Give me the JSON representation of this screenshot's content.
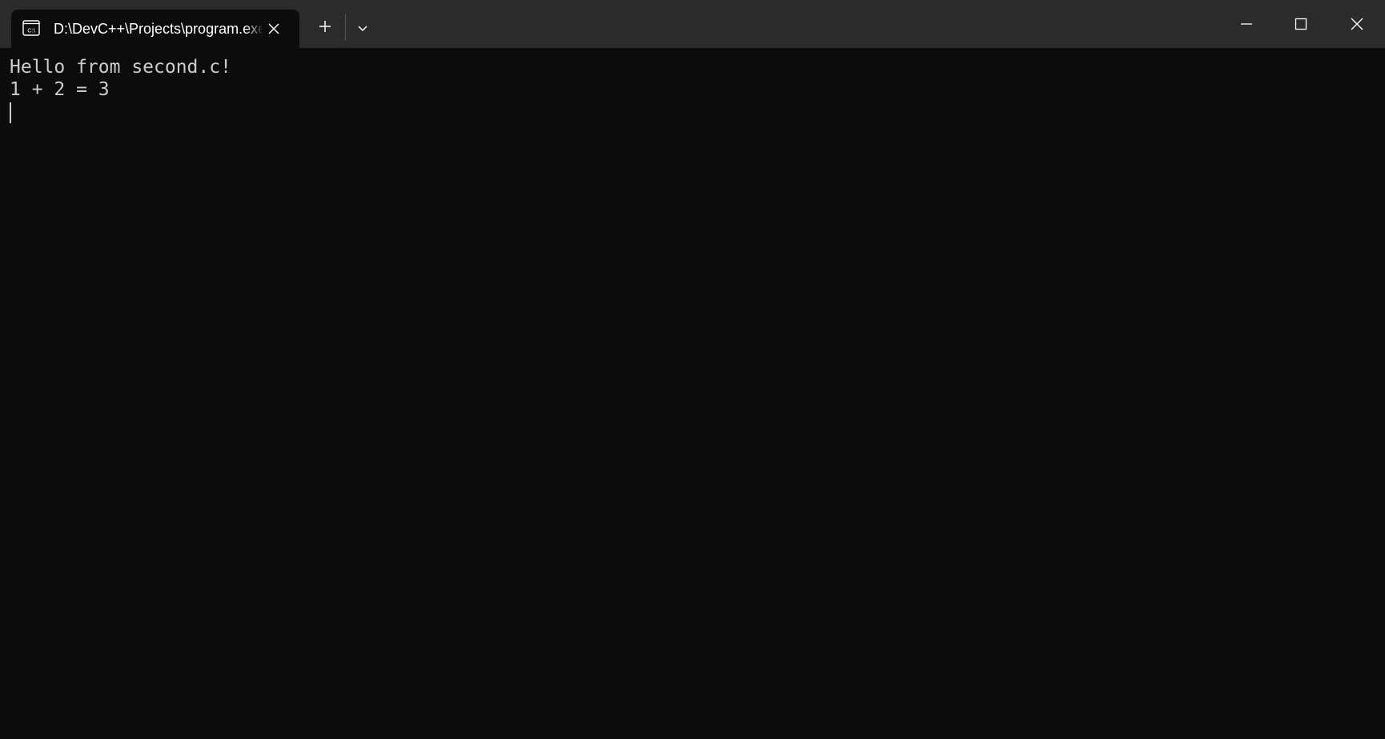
{
  "window": {
    "tab_title": "D:\\DevC++\\Projects\\program.exe",
    "tab_icon": "cmd-console-icon",
    "colors": {
      "titlebar": "#2b2b2b",
      "background": "#0c0c0c",
      "text": "#cccccc"
    }
  },
  "console": {
    "lines": [
      "Hello from second.c!",
      "1 + 2 = 3"
    ]
  }
}
